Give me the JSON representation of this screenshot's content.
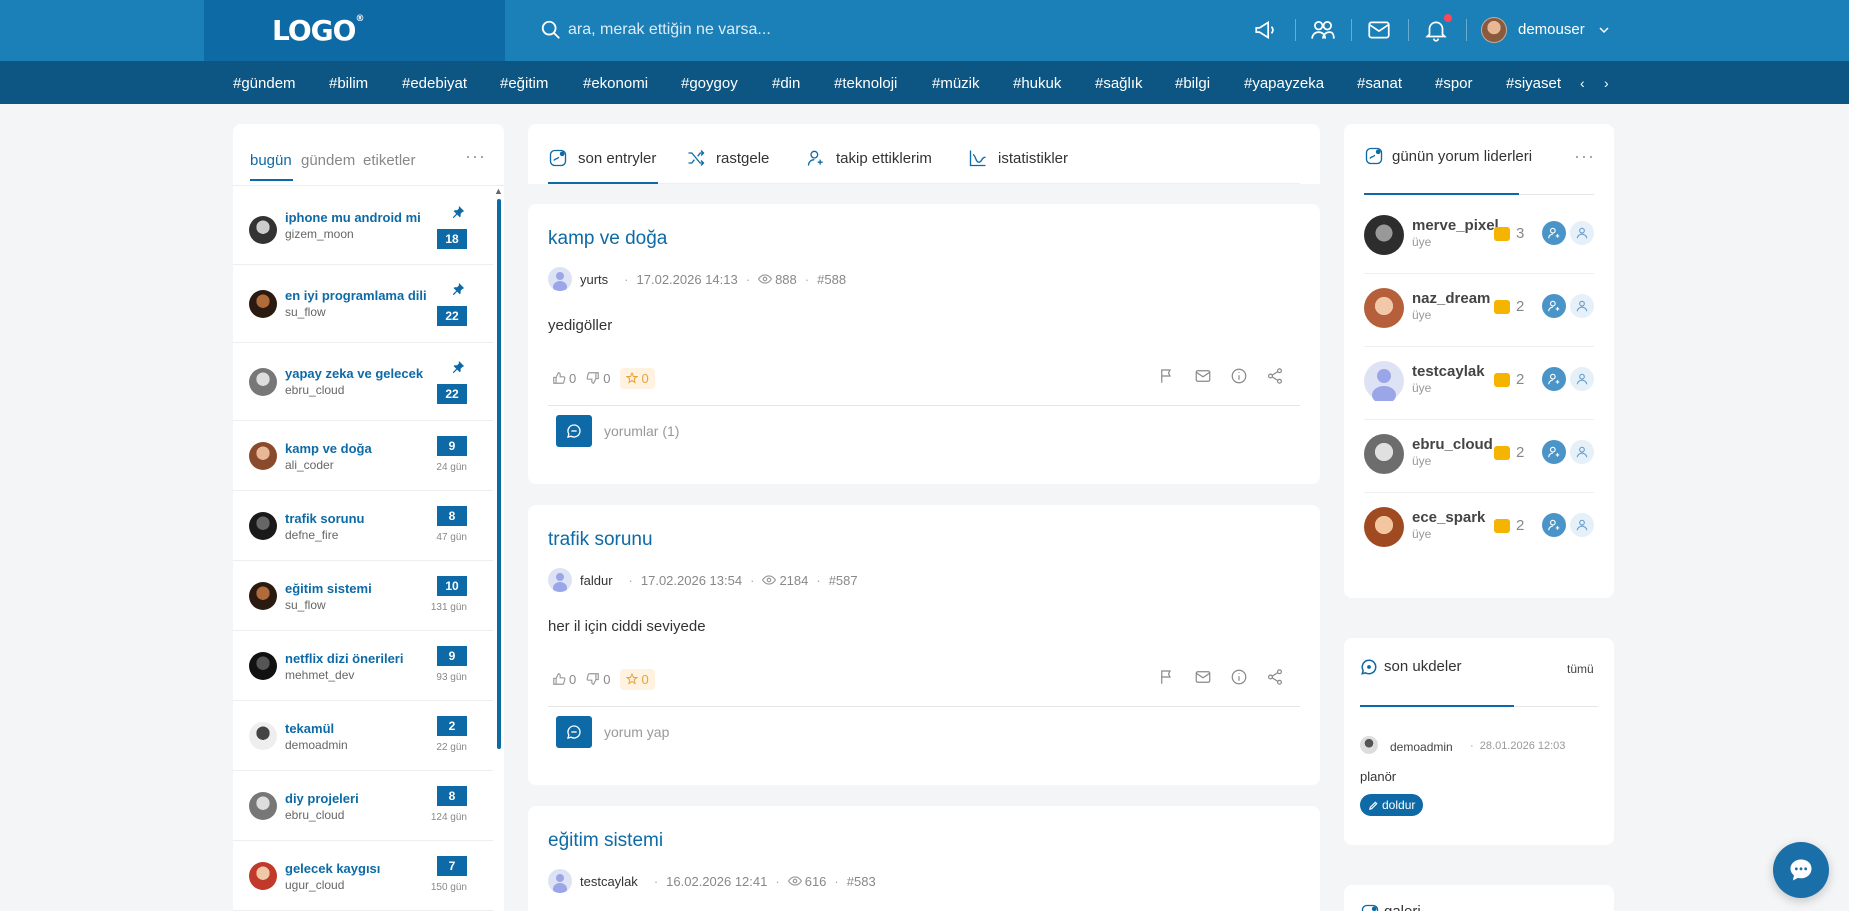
{
  "header": {
    "logo_text": "LOGO",
    "search_placeholder": "ara, merak ettiğin ne varsa...",
    "username": "demouser",
    "icons": [
      "megaphone-icon",
      "users-icon",
      "mail-icon",
      "bell-icon",
      "chevron-down-icon"
    ],
    "colors": {
      "bar": "#1b7fb8",
      "logo_area": "#0e6aa4",
      "tagbar": "#0d5684",
      "accent": "#0d6aa6"
    }
  },
  "tags": [
    "#gündem",
    "#bilim",
    "#edebiyat",
    "#eğitim",
    "#ekonomi",
    "#goygoy",
    "#din",
    "#teknoloji",
    "#müzik",
    "#hukuk",
    "#sağlık",
    "#bilgi",
    "#yapayzeka",
    "#sanat",
    "#spor",
    "#siyaset"
  ],
  "tag_nav": {
    "prev": "‹",
    "next": "›"
  },
  "left": {
    "tabs": [
      "bugün",
      "gündem",
      "etiketler"
    ],
    "active_tab": "bugün",
    "more": "···",
    "topics": [
      {
        "title": "iphone mu android mi",
        "user": "gizem_moon",
        "count": "18",
        "pinned": true,
        "age": ""
      },
      {
        "title": "en iyi programlama dili",
        "user": "su_flow",
        "count": "22",
        "pinned": true,
        "age": ""
      },
      {
        "title": "yapay zeka ve gelecek",
        "user": "ebru_cloud",
        "count": "22",
        "pinned": true,
        "age": ""
      },
      {
        "title": "kamp ve doğa",
        "user": "ali_coder",
        "count": "9",
        "pinned": false,
        "age": "24 gün"
      },
      {
        "title": "trafik sorunu",
        "user": "defne_fire",
        "count": "8",
        "pinned": false,
        "age": "47 gün"
      },
      {
        "title": "eğitim sistemi",
        "user": "su_flow",
        "count": "10",
        "pinned": false,
        "age": "131 gün"
      },
      {
        "title": "netflix dizi önerileri",
        "user": "mehmet_dev",
        "count": "9",
        "pinned": false,
        "age": "93 gün"
      },
      {
        "title": "tekamül",
        "user": "demoadmin",
        "count": "2",
        "pinned": false,
        "age": "22 gün"
      },
      {
        "title": "diy projeleri",
        "user": "ebru_cloud",
        "count": "8",
        "pinned": false,
        "age": "124 gün"
      },
      {
        "title": "gelecek kaygısı",
        "user": "ugur_cloud",
        "count": "7",
        "pinned": false,
        "age": "150 gün"
      }
    ]
  },
  "center": {
    "tabs": [
      "son entryler",
      "rastgele",
      "takip ettiklerim",
      "istatistikler"
    ],
    "active_tab": "son entryler",
    "entries": [
      {
        "title": "kamp ve doğa",
        "user": "yurts",
        "date": "17.02.2026 14:13",
        "views": "888",
        "id": "#588",
        "body": "yedigöller",
        "likes": "0",
        "dislikes": "0",
        "stars": "0",
        "comment_label": "yorumlar (1)"
      },
      {
        "title": "trafik sorunu",
        "user": "faldur",
        "date": "17.02.2026 13:54",
        "views": "2184",
        "id": "#587",
        "body": "her il için ciddi seviyede",
        "likes": "0",
        "dislikes": "0",
        "stars": "0",
        "comment_label": "yorum yap"
      },
      {
        "title": "eğitim sistemi",
        "user": "testcaylak",
        "date": "16.02.2026 12:41",
        "views": "616",
        "id": "#583",
        "body": "",
        "likes": "",
        "dislikes": "",
        "stars": "",
        "comment_label": ""
      }
    ]
  },
  "leaders": {
    "title": "günün yorum liderleri",
    "more": "···",
    "items": [
      {
        "name": "merve_pixel",
        "role": "üye",
        "count": "3"
      },
      {
        "name": "naz_dream",
        "role": "üye",
        "count": "2"
      },
      {
        "name": "testcaylak",
        "role": "üye",
        "count": "2"
      },
      {
        "name": "ebru_cloud",
        "role": "üye",
        "count": "2"
      },
      {
        "name": "ece_spark",
        "role": "üye",
        "count": "2"
      }
    ]
  },
  "ukde": {
    "title": "son ukdeler",
    "all_label": "tümü",
    "user": "demoadmin",
    "date": "28.01.2026 12:03",
    "body": "planör",
    "button": "doldur"
  },
  "galeri": {
    "title": "galeri"
  }
}
